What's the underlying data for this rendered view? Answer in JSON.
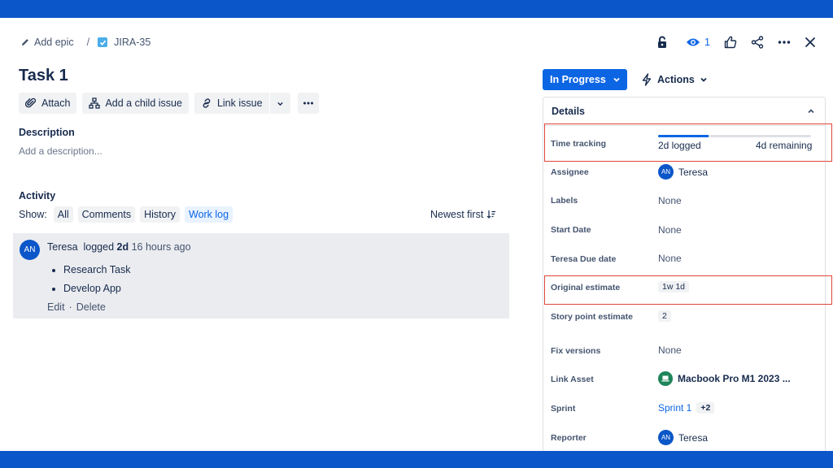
{
  "breadcrumb": {
    "add_epic": "Add epic",
    "separator": "/",
    "issue_key": "JIRA-35"
  },
  "issue": {
    "title": "Task 1"
  },
  "toolbar": {
    "attach": "Attach",
    "add_child": "Add a child issue",
    "link_issue": "Link issue"
  },
  "description": {
    "label": "Description",
    "placeholder": "Add a description..."
  },
  "activity": {
    "label": "Activity",
    "show_label": "Show:",
    "filters": [
      "All",
      "Comments",
      "History",
      "Work log"
    ],
    "selected_filter": "Work log",
    "sort": "Newest first"
  },
  "worklog": {
    "avatar": "AN",
    "user": "Teresa",
    "action": "logged",
    "amount": "2d",
    "time": "16 hours ago",
    "items": [
      "Research Task",
      "Develop App"
    ],
    "edit": "Edit",
    "dot": "·",
    "delete": "Delete"
  },
  "header": {
    "watch_count": "1"
  },
  "status": {
    "label": "In Progress"
  },
  "actions": {
    "label": "Actions"
  },
  "details": {
    "title": "Details",
    "time_tracking": {
      "label": "Time tracking",
      "logged": "2d logged",
      "remaining": "4d remaining",
      "progress_fraction": 0.33
    },
    "assignee": {
      "label": "Assignee",
      "avatar": "AN",
      "name": "Teresa"
    },
    "labels": {
      "label": "Labels",
      "value": "None"
    },
    "start_date": {
      "label": "Start Date",
      "value": "None"
    },
    "due_date": {
      "label": "Teresa Due date",
      "value": "None"
    },
    "original_estimate": {
      "label": "Original estimate",
      "value": "1w 1d"
    },
    "story_points": {
      "label": "Story point estimate",
      "value": "2"
    },
    "fix_versions": {
      "label": "Fix versions",
      "value": "None"
    },
    "link_asset": {
      "label": "Link Asset",
      "value": "Macbook Pro M1 2023 ..."
    },
    "sprint": {
      "label": "Sprint",
      "value": "Sprint 1",
      "extra": "+2"
    },
    "reporter": {
      "label": "Reporter",
      "avatar": "AN",
      "name": "Teresa"
    }
  },
  "colors": {
    "brand_bar": "#0b56c8",
    "primary": "#0c66e4",
    "highlight": "#e0453a"
  }
}
